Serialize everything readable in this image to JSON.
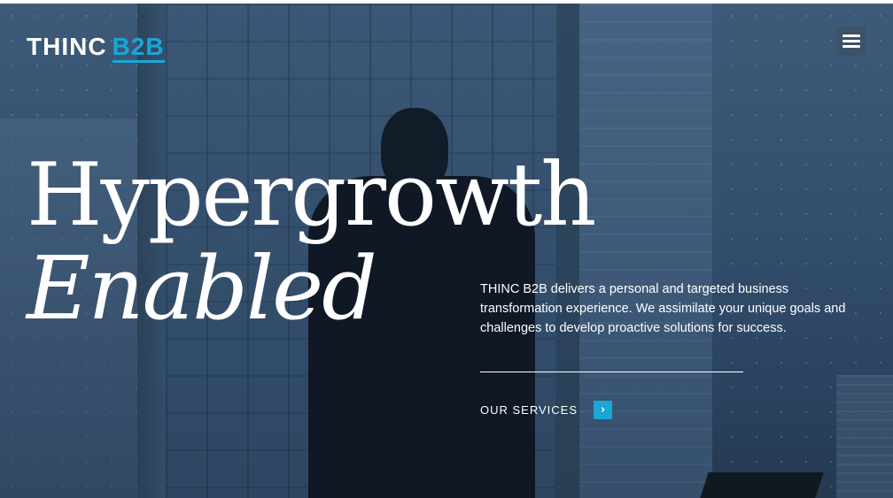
{
  "brand": {
    "name_part1": "THINC",
    "name_part2": "B2B",
    "primary_color": "#ffffff",
    "accent_color": "#1aa7d8"
  },
  "header": {
    "menu_icon": "hamburger-menu-icon"
  },
  "hero": {
    "headline_line1": "Hypergrowth",
    "headline_line2": "Enabled",
    "description": "THINC B2B delivers a personal and targeted business transformation experience. We assimilate your unique goals and challenges to develop proactive solutions for success.",
    "cta_label": "OUR SERVICES",
    "cta_icon": "chevron-right-icon",
    "cta_arrow_glyph": "›"
  }
}
